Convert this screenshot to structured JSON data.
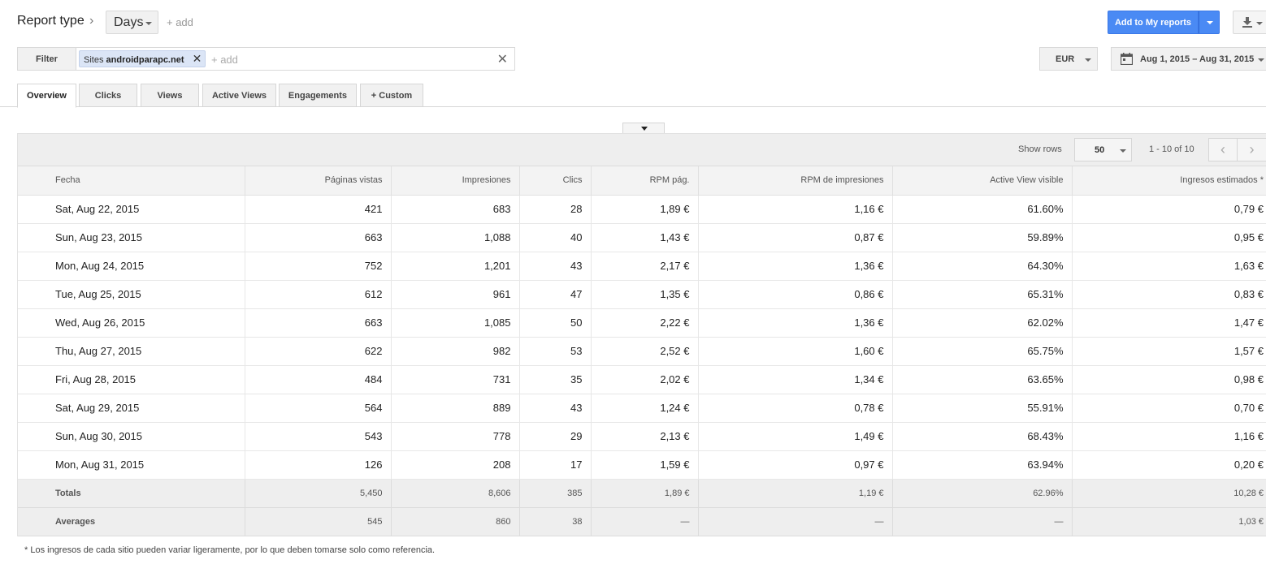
{
  "header": {
    "report_type": "Report type",
    "breadcrumb_arrow": "›",
    "dimension": "Days",
    "add_dimension": "+ add",
    "add_to_reports": "Add to My reports"
  },
  "filter": {
    "button": "Filter",
    "chip_prefix": "Sites",
    "chip_value": "androidparapc.net",
    "chip_remove": "✕",
    "add_placeholder": "+ add",
    "clear": "✕"
  },
  "currency": "EUR",
  "date_range": "Aug 1, 2015 – Aug 31, 2015",
  "tabs": [
    {
      "label": "Overview",
      "active": true
    },
    {
      "label": "Clicks"
    },
    {
      "label": "Views"
    },
    {
      "label": "Active Views"
    },
    {
      "label": "Engagements"
    },
    {
      "label": "+  Custom"
    }
  ],
  "table": {
    "show_rows_label": "Show rows",
    "rows_value": "50",
    "page_info": "1 - 10 of 10",
    "prev": "‹",
    "next": "›",
    "columns": [
      "Fecha",
      "Páginas vistas",
      "Impresiones",
      "Clics",
      "RPM pág.",
      "RPM de impresiones",
      "Active View visible",
      "Ingresos estimados *"
    ],
    "rows": [
      [
        "Sat, Aug 22, 2015",
        "421",
        "683",
        "28",
        "1,89 €",
        "1,16 €",
        "61.60%",
        "0,79 €"
      ],
      [
        "Sun, Aug 23, 2015",
        "663",
        "1,088",
        "40",
        "1,43 €",
        "0,87 €",
        "59.89%",
        "0,95 €"
      ],
      [
        "Mon, Aug 24, 2015",
        "752",
        "1,201",
        "43",
        "2,17 €",
        "1,36 €",
        "64.30%",
        "1,63 €"
      ],
      [
        "Tue, Aug 25, 2015",
        "612",
        "961",
        "47",
        "1,35 €",
        "0,86 €",
        "65.31%",
        "0,83 €"
      ],
      [
        "Wed, Aug 26, 2015",
        "663",
        "1,085",
        "50",
        "2,22 €",
        "1,36 €",
        "62.02%",
        "1,47 €"
      ],
      [
        "Thu, Aug 27, 2015",
        "622",
        "982",
        "53",
        "2,52 €",
        "1,60 €",
        "65.75%",
        "1,57 €"
      ],
      [
        "Fri, Aug 28, 2015",
        "484",
        "731",
        "35",
        "2,02 €",
        "1,34 €",
        "63.65%",
        "0,98 €"
      ],
      [
        "Sat, Aug 29, 2015",
        "564",
        "889",
        "43",
        "1,24 €",
        "0,78 €",
        "55.91%",
        "0,70 €"
      ],
      [
        "Sun, Aug 30, 2015",
        "543",
        "778",
        "29",
        "2,13 €",
        "1,49 €",
        "68.43%",
        "1,16 €"
      ],
      [
        "Mon, Aug 31, 2015",
        "126",
        "208",
        "17",
        "1,59 €",
        "0,97 €",
        "63.94%",
        "0,20 €"
      ]
    ],
    "totals": [
      "Totals",
      "5,450",
      "8,606",
      "385",
      "1,89 €",
      "1,19 €",
      "62.96%",
      "10,28 €"
    ],
    "averages": [
      "Averages",
      "545",
      "860",
      "38",
      "—",
      "—",
      "—",
      "1,03 €"
    ]
  },
  "footnote": "* Los ingresos de cada sitio pueden variar ligeramente, por lo que deben tomarse solo como referencia.",
  "colors": {
    "primary_button": "#4a8af4",
    "chip_bg": "#dbe5f6"
  },
  "icons": [
    "calendar-icon",
    "download-icon",
    "close-icon",
    "chevron-left-icon",
    "chevron-right-icon",
    "caret-down-icon"
  ]
}
